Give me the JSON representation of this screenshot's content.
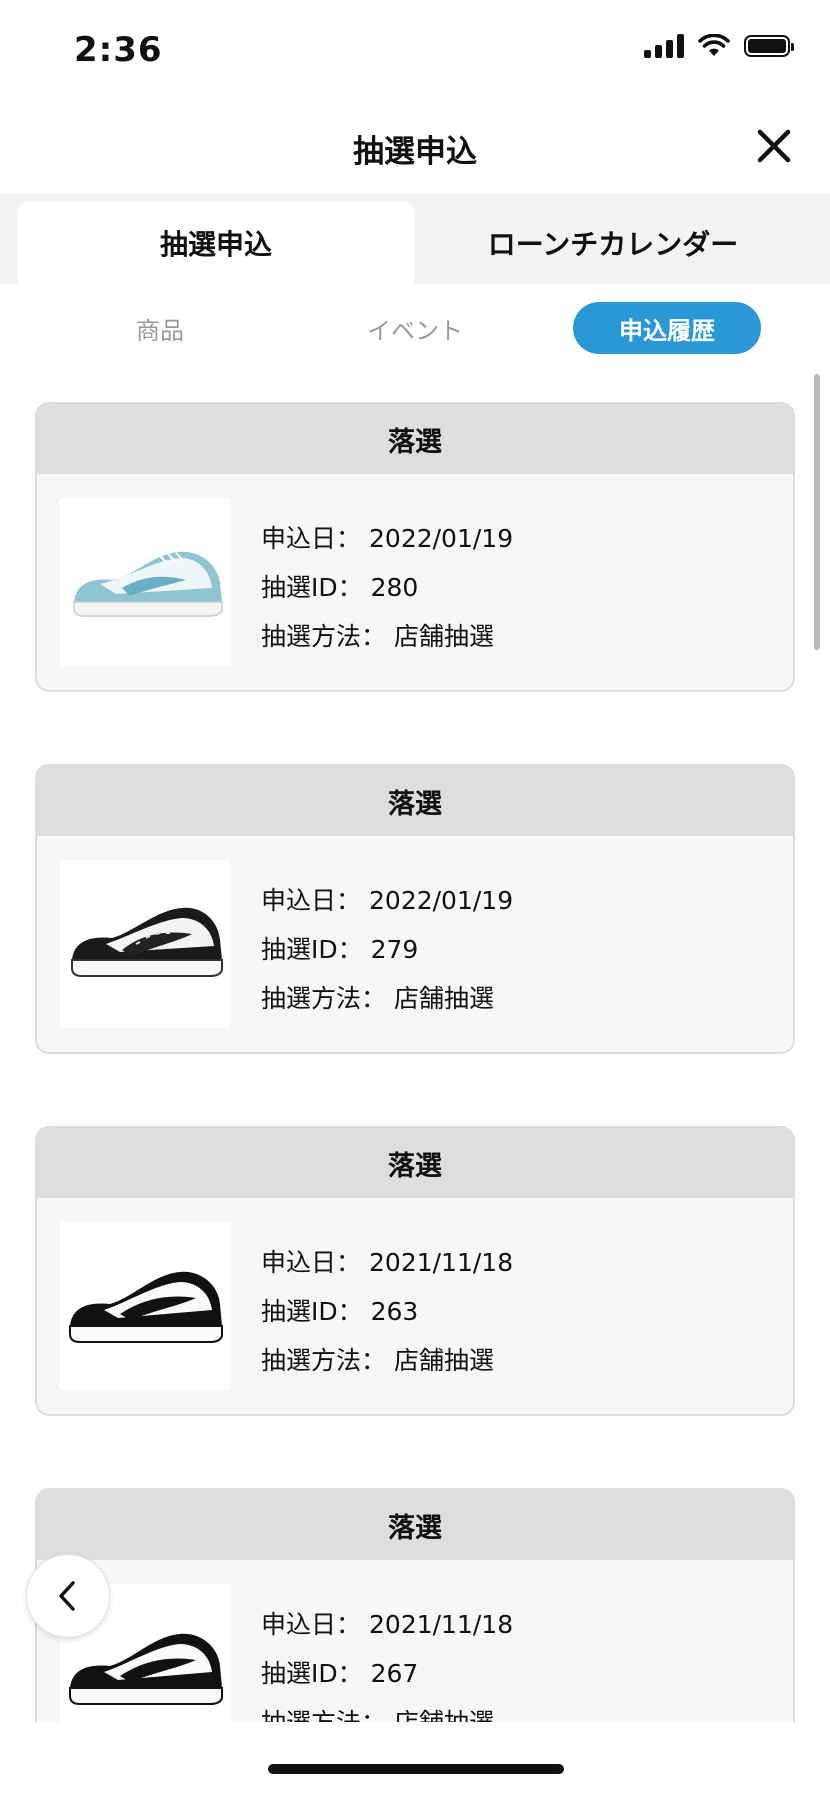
{
  "status_bar": {
    "time": "2:36"
  },
  "header": {
    "title": "抽選申込",
    "close_icon": "close-icon"
  },
  "main_tabs": [
    {
      "label": "抽選申込",
      "active": true
    },
    {
      "label": "ローンチカレンダー",
      "active": false
    }
  ],
  "sub_tabs": [
    {
      "label": "商品",
      "active": false
    },
    {
      "label": "イベント",
      "active": false
    },
    {
      "label": "申込履歴",
      "active": true
    }
  ],
  "entries": [
    {
      "status": "落選",
      "date_label": "申込日：",
      "date": "2022/01/19",
      "id_label": "抽選ID：",
      "id": "280",
      "method_label": "抽選方法：",
      "method": "店舗抽選",
      "image": "sneaker-light-blue"
    },
    {
      "status": "落選",
      "date_label": "申込日：",
      "date": "2022/01/19",
      "id_label": "抽選ID：",
      "id": "279",
      "method_label": "抽選方法：",
      "method": "店舗抽選",
      "image": "sneaker-black-paisley"
    },
    {
      "status": "落選",
      "date_label": "申込日：",
      "date": "2021/11/18",
      "id_label": "抽選ID：",
      "id": "263",
      "method_label": "抽選方法：",
      "method": "店舗抽選",
      "image": "sneaker-black-white"
    },
    {
      "status": "落選",
      "date_label": "申込日：",
      "date": "2021/11/18",
      "id_label": "抽選ID：",
      "id": "267",
      "method_label": "抽選方法：",
      "method": "店舗抽選",
      "image": "sneaker-black-white"
    }
  ],
  "colors": {
    "accent": "#2a98d4",
    "card_header": "#dedede",
    "card_bg": "#f7f7f7"
  },
  "back_icon": "chevron-left-icon"
}
